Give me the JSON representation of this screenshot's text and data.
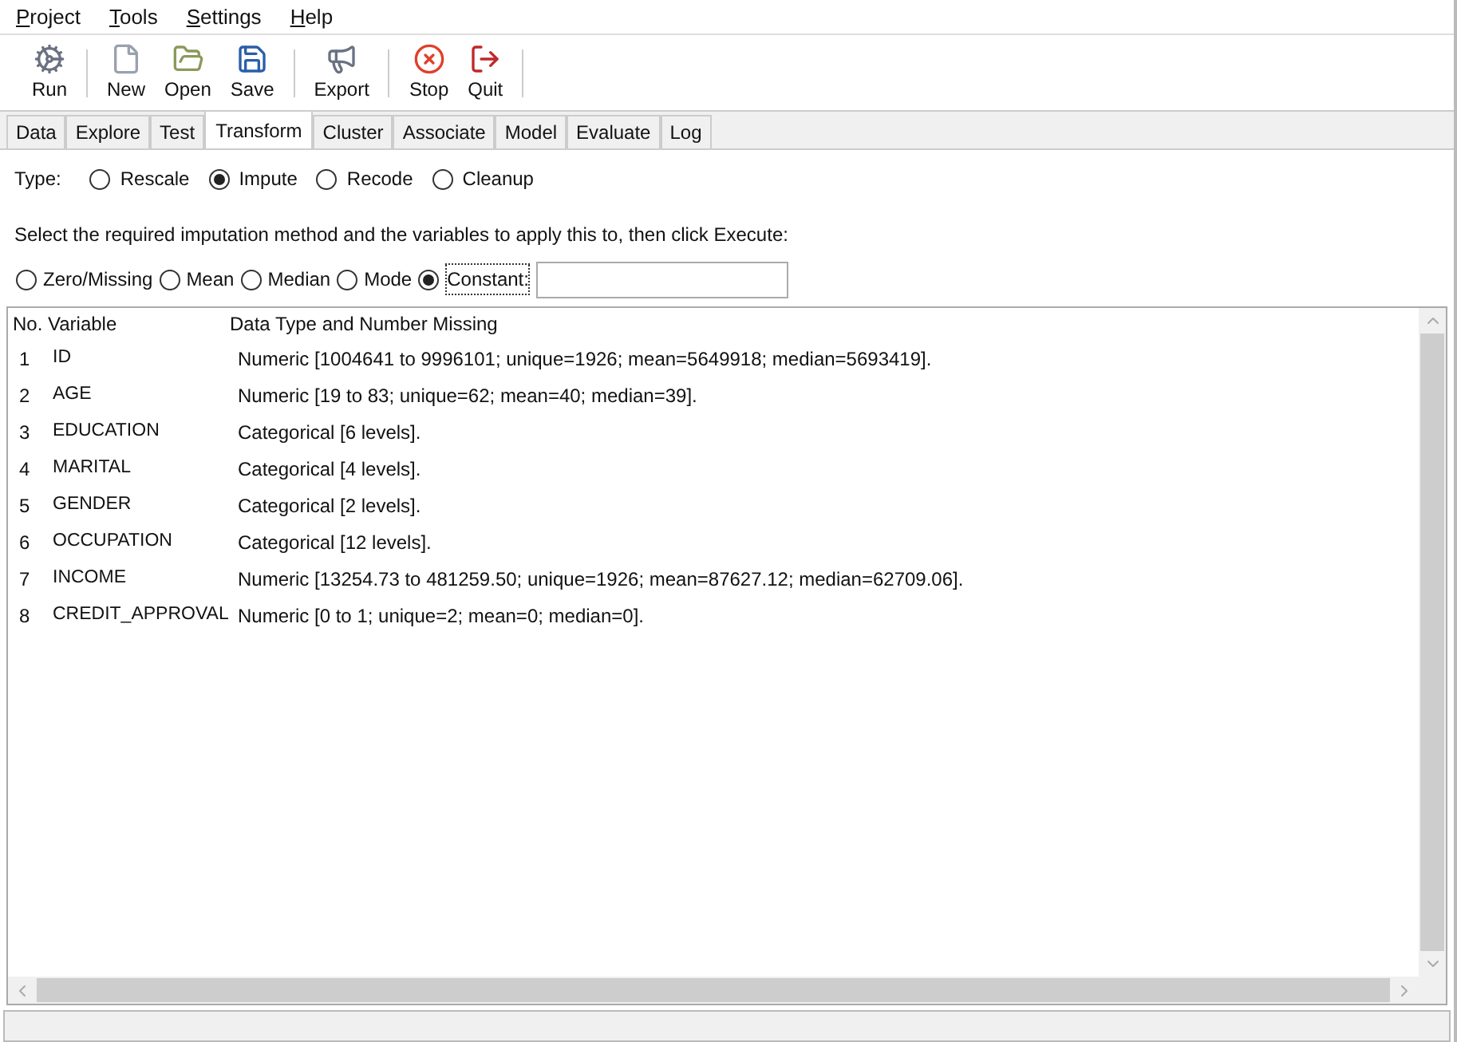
{
  "menu": [
    "Project",
    "Tools",
    "Settings",
    "Help"
  ],
  "toolbar": [
    {
      "label": "Run",
      "kind": "gears",
      "separator_after": true
    },
    {
      "label": "New",
      "kind": "new",
      "separator_after": false
    },
    {
      "label": "Open",
      "kind": "open",
      "separator_after": false
    },
    {
      "label": "Save",
      "kind": "save",
      "separator_after": true
    },
    {
      "label": "Export",
      "kind": "export",
      "separator_after": true
    },
    {
      "label": "Stop",
      "kind": "stop",
      "separator_after": false
    },
    {
      "label": "Quit",
      "kind": "quit",
      "separator_after": true
    }
  ],
  "tabs": [
    {
      "label": "Data",
      "selected": false
    },
    {
      "label": "Explore",
      "selected": false
    },
    {
      "label": "Test",
      "selected": false
    },
    {
      "label": "Transform",
      "selected": true
    },
    {
      "label": "Cluster",
      "selected": false
    },
    {
      "label": "Associate",
      "selected": false
    },
    {
      "label": "Model",
      "selected": false
    },
    {
      "label": "Evaluate",
      "selected": false
    },
    {
      "label": "Log",
      "selected": false
    }
  ],
  "type": {
    "label": "Type:",
    "options": [
      {
        "label": "Rescale",
        "selected": false
      },
      {
        "label": "Impute",
        "selected": true
      },
      {
        "label": "Recode",
        "selected": false
      },
      {
        "label": "Cleanup",
        "selected": false
      }
    ]
  },
  "instruction": "Select the required imputation method and the variables to apply this to, then click Execute:",
  "methods": [
    {
      "label": "Zero/Missing",
      "selected": false
    },
    {
      "label": "Mean",
      "selected": false
    },
    {
      "label": "Median",
      "selected": false
    },
    {
      "label": "Mode",
      "selected": false
    },
    {
      "label": "Constant:",
      "selected": true
    }
  ],
  "table": {
    "columns": [
      "No.",
      "Variable",
      "Data Type and Number Missing"
    ],
    "rows": [
      [
        "1",
        "ID",
        "Numeric [1004641 to 9996101; unique=1926; mean=5649918; median=5693419]."
      ],
      [
        "2",
        "AGE",
        "Numeric [19 to 83; unique=62; mean=40; median=39]."
      ],
      [
        "3",
        "EDUCATION",
        "Categorical [6 levels]."
      ],
      [
        "4",
        "MARITAL",
        "Categorical [4 levels]."
      ],
      [
        "5",
        "GENDER",
        "Categorical [2 levels]."
      ],
      [
        "6",
        "OCCUPATION",
        "Categorical [12 levels]."
      ],
      [
        "7",
        "INCOME",
        "Numeric [13254.73 to 481259.50; unique=1926; mean=87627.12; median=62709.06]."
      ],
      [
        "8",
        "CREDIT_APPROVAL",
        "Numeric [0 to 1; unique=2; mean=0; median=0]."
      ]
    ]
  }
}
